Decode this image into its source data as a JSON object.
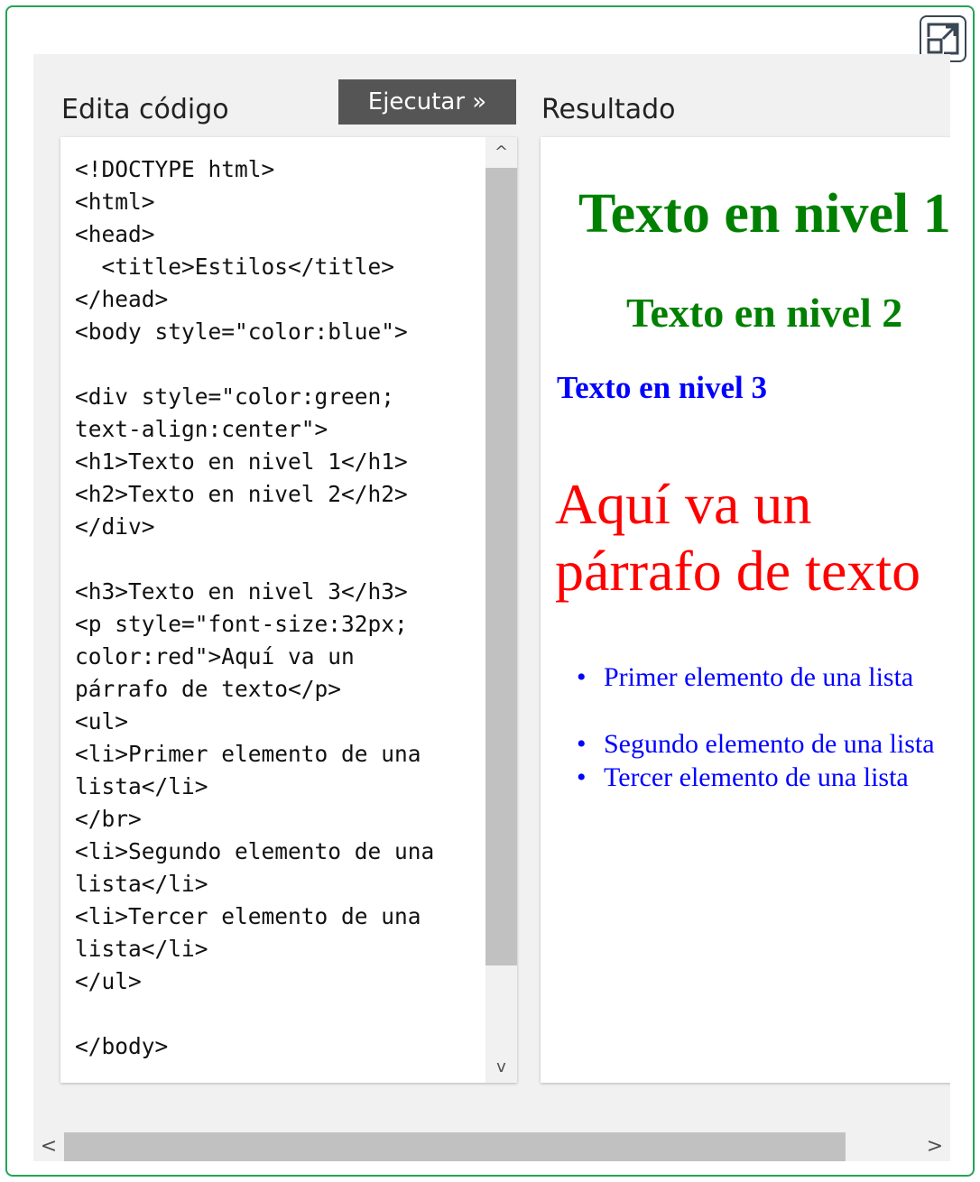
{
  "toolbar": {
    "expand_icon": "expand-icon",
    "edit_label": "Edita código",
    "run_label": "Ejecutar »",
    "result_label": "Resultado"
  },
  "code": {
    "text": "<!DOCTYPE html>\n<html>\n<head>\n  <title>Estilos</title>\n</head>\n<body style=\"color:blue\">\n\n<div style=\"color:green;\ntext-align:center\">\n<h1>Texto en nivel 1</h1>\n<h2>Texto en nivel 2</h2>\n</div>\n\n<h3>Texto en nivel 3</h3>\n<p style=\"font-size:32px;\ncolor:red\">Aquí va un\npárrafo de texto</p>\n<ul>\n<li>Primer elemento de una\nlista</li>\n</br>\n<li>Segundo elemento de una\nlista</li>\n<li>Tercer elemento de una\nlista</li>\n</ul>\n\n</body>"
  },
  "result": {
    "h1": "Texto en nivel 1",
    "h2": "Texto en nivel 2",
    "h3": "Texto en nivel 3",
    "paragraph": "Aquí va un párrafo de texto",
    "list_items": [
      "Primer elemento de una lista",
      "Segundo elemento de una lista",
      "Tercer elemento de una lista"
    ]
  },
  "scrollbars": {
    "up_arrow": "^",
    "down_arrow": "v",
    "left_arrow": "<",
    "right_arrow": ">"
  },
  "colors": {
    "frame_border": "#23a455",
    "run_button": "#555555",
    "h1_h2": "#008000",
    "body_text": "#0000ff",
    "paragraph": "#ff0000"
  }
}
